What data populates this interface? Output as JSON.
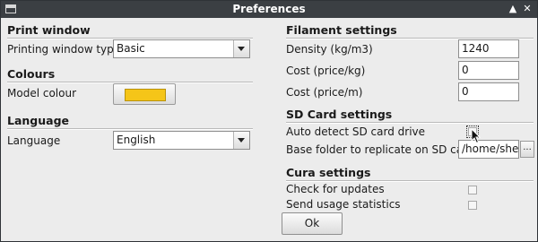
{
  "window": {
    "title": "Preferences"
  },
  "left": {
    "print_window": {
      "heading": "Print window",
      "type_label": "Printing window type",
      "type_value": "Basic"
    },
    "colours": {
      "heading": "Colours",
      "model_label": "Model colour",
      "model_colour": "#f5c518"
    },
    "language": {
      "heading": "Language",
      "label": "Language",
      "value": "English"
    }
  },
  "right": {
    "filament": {
      "heading": "Filament settings",
      "density_label": "Density (kg/m3)",
      "density_value": "1240",
      "cost_kg_label": "Cost (price/kg)",
      "cost_kg_value": "0",
      "cost_m_label": "Cost (price/m)",
      "cost_m_value": "0"
    },
    "sdcard": {
      "heading": "SD Card settings",
      "auto_detect_label": "Auto detect SD card drive",
      "base_folder_label": "Base folder to replicate on SD card",
      "base_folder_value": "/home/shev",
      "browse_label": "..."
    },
    "cura": {
      "heading": "Cura settings",
      "updates_label": "Check for updates",
      "stats_label": "Send usage statistics"
    }
  },
  "footer": {
    "ok_label": "Ok"
  }
}
